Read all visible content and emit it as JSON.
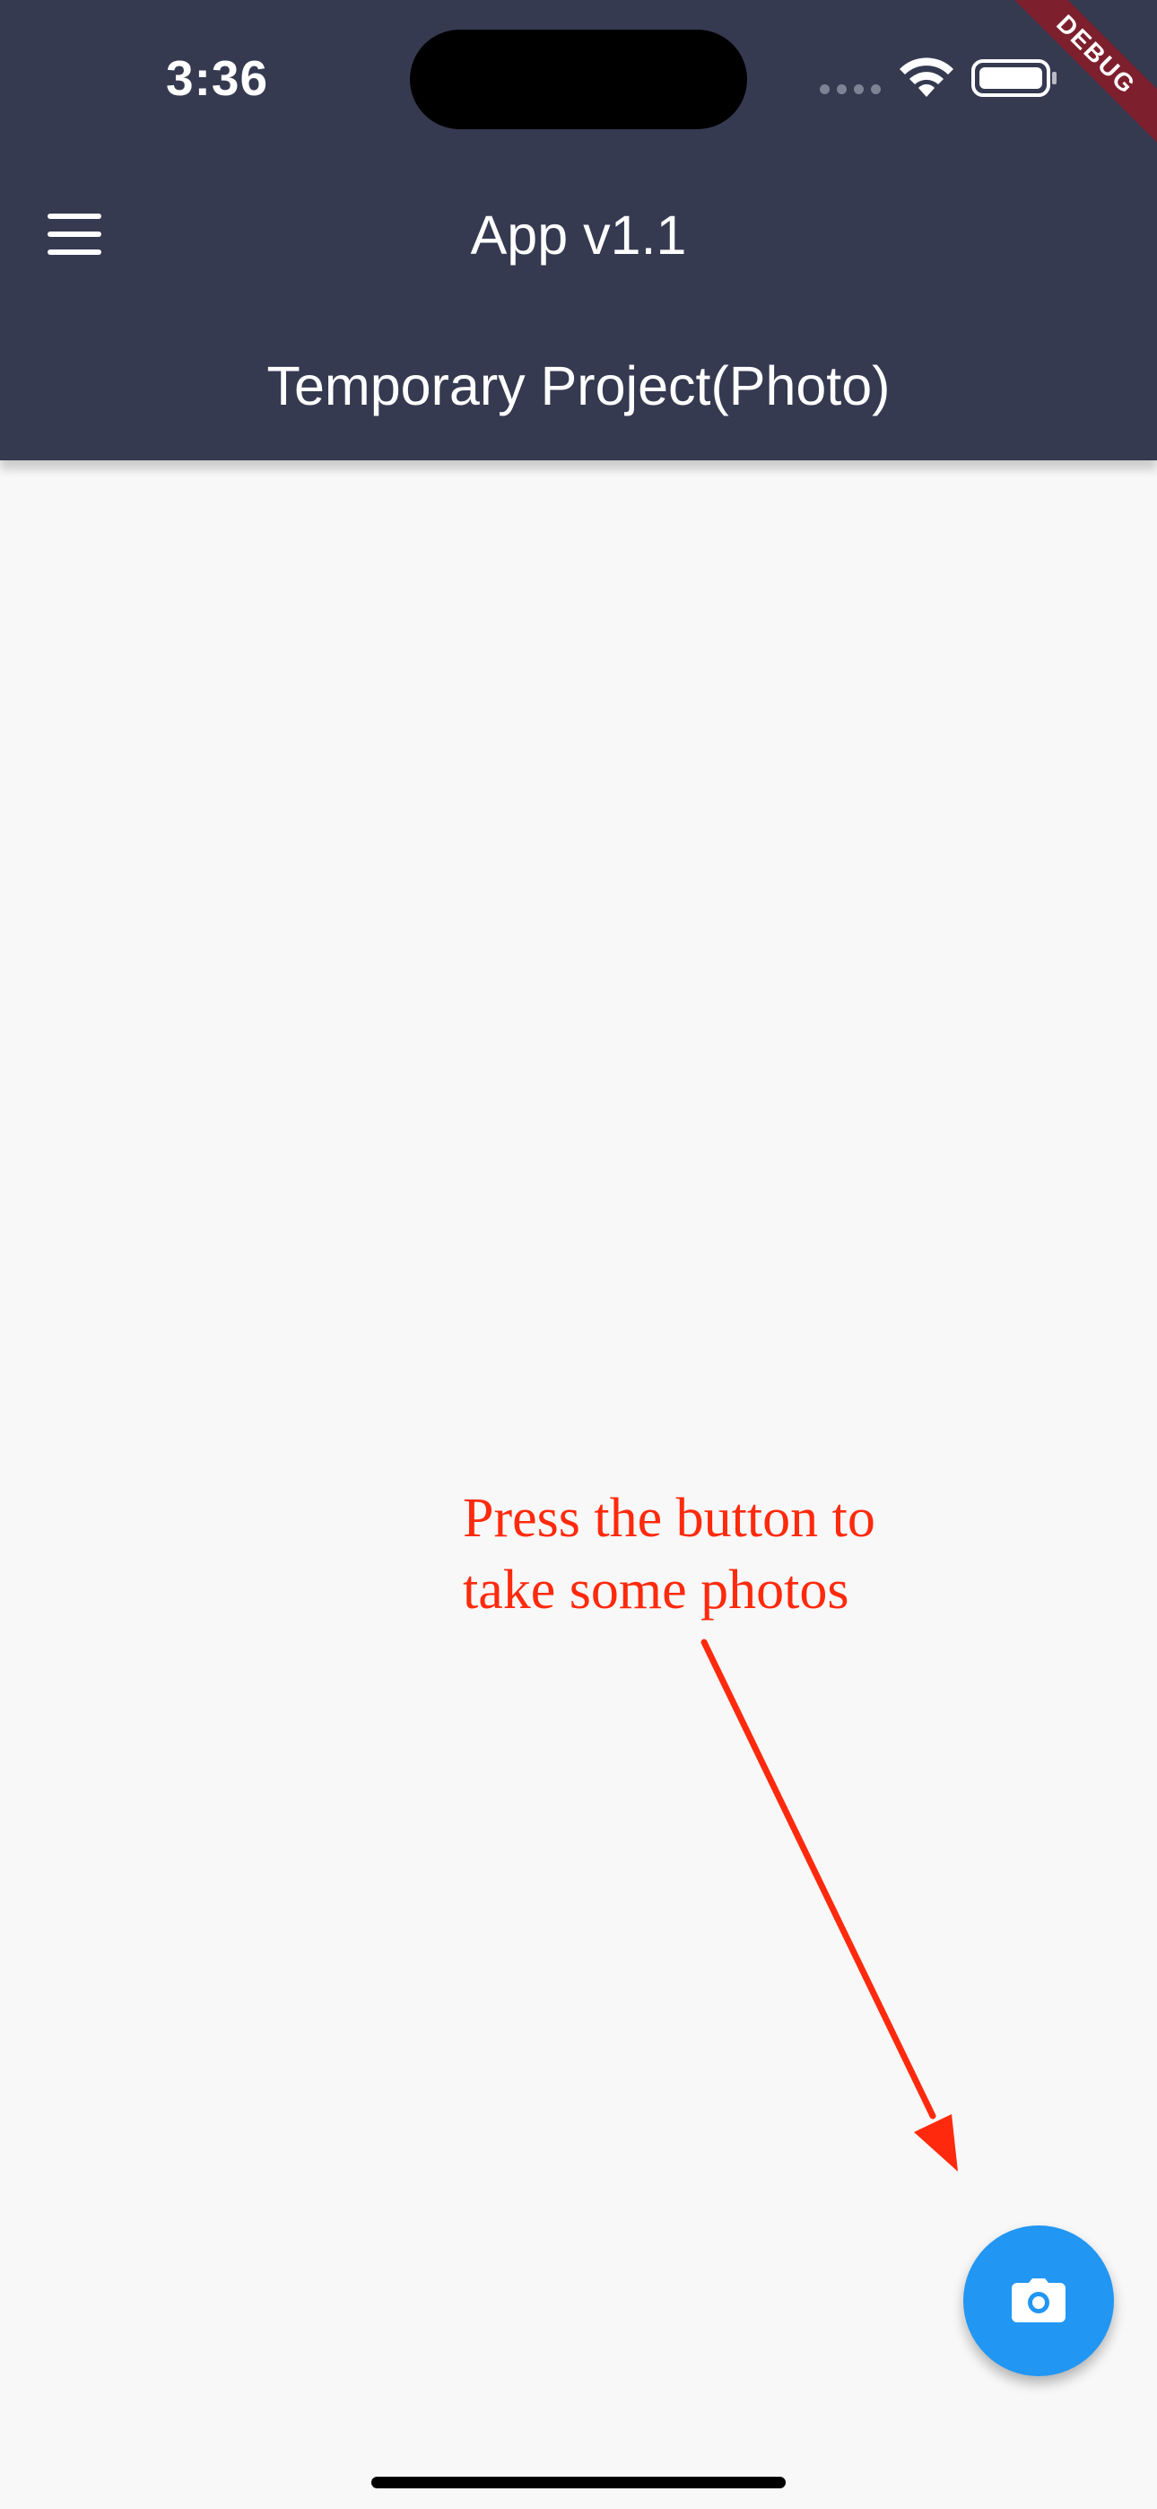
{
  "status_bar": {
    "time": "3:36",
    "icons": [
      "signal-dots-icon",
      "wifi-icon",
      "battery-icon"
    ]
  },
  "app_bar": {
    "title": "App v1.1",
    "menu_icon": "hamburger-menu-icon"
  },
  "project_header": {
    "title": "Temporary Project(Photo)"
  },
  "debug_banner": "DEBUG",
  "annotation": {
    "text": "Press the button to\ntake some photos"
  },
  "fab": {
    "icon": "camera-icon"
  },
  "colors": {
    "app_bar": "#353a51",
    "background": "#f8f8f8",
    "fab": "#2196f3",
    "annotation": "#ff2a0d",
    "debug_banner": "#7d1f2d"
  }
}
